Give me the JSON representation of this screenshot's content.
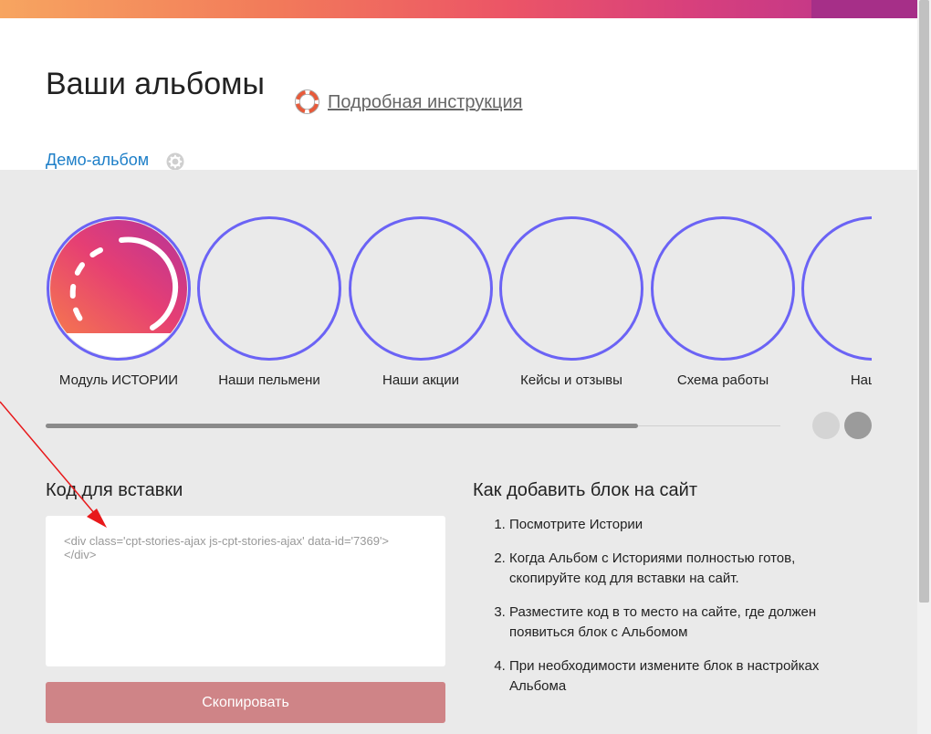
{
  "header": {
    "title": "Ваши альбомы",
    "help_link": "Подробная инструкция",
    "album_link": "Демо-альбом"
  },
  "stories": [
    {
      "label": "Модуль ИСТОРИИ",
      "has_cover": true
    },
    {
      "label": "Наши пельмени",
      "has_cover": false
    },
    {
      "label": "Наши акции",
      "has_cover": false
    },
    {
      "label": "Кейсы и отзывы",
      "has_cover": false
    },
    {
      "label": "Схема работы",
      "has_cover": false
    },
    {
      "label": "Наши к",
      "has_cover": false
    }
  ],
  "carousel": {
    "scroll_progress": 0.806
  },
  "embed": {
    "title": "Код для вставки",
    "code": "<div class='cpt-stories-ajax js-cpt-stories-ajax' data-id='7369'>\n</div>",
    "copy_label": "Скопировать"
  },
  "howto": {
    "title": "Как добавить блок на сайт",
    "steps": [
      "Посмотрите Истории",
      "Когда Альбом с Историями полностью готов, скопируйте код для вставки на сайт.",
      "Разместите код в то место на сайте, где должен появиться блок с Альбомом",
      "При необходимости измените блок в настройках Альбома"
    ]
  },
  "colors": {
    "ring": "#6b63f5",
    "link": "#1e7fc8",
    "copy_button": "#cf8487",
    "annotation_arrow": "#e8191b"
  },
  "icons": {
    "help": "lifebuoy-icon",
    "album_settings": "gear-icon"
  }
}
